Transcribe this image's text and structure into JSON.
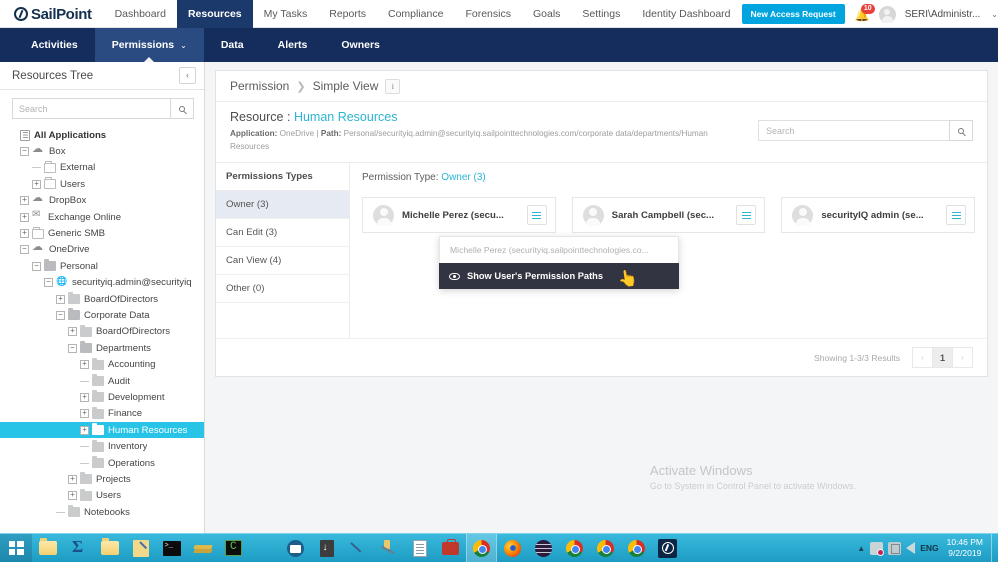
{
  "app": {
    "brand": "SailPoint",
    "brand_icon": "sailpoint-logo-icon"
  },
  "topnav": {
    "items": [
      {
        "label": "Dashboard",
        "active": false
      },
      {
        "label": "Resources",
        "active": true
      },
      {
        "label": "My Tasks",
        "active": false
      },
      {
        "label": "Reports",
        "active": false
      },
      {
        "label": "Compliance",
        "active": false
      },
      {
        "label": "Forensics",
        "active": false
      },
      {
        "label": "Goals",
        "active": false
      },
      {
        "label": "Settings",
        "active": false
      },
      {
        "label": "Identity Dashboard",
        "active": false
      }
    ],
    "new_access_request": "New Access Request",
    "notification_count": "10",
    "user": "SERI\\Administr...",
    "user_caret": "⌄"
  },
  "subnav": {
    "items": [
      {
        "label": "Activities",
        "active": false,
        "caret": ""
      },
      {
        "label": "Permissions",
        "active": true,
        "caret": "⌄"
      },
      {
        "label": "Data",
        "active": false,
        "caret": ""
      },
      {
        "label": "Alerts",
        "active": false,
        "caret": ""
      },
      {
        "label": "Owners",
        "active": false,
        "caret": ""
      }
    ]
  },
  "sidebar": {
    "title": "Resources Tree",
    "collapse_glyph": "‹",
    "search_placeholder": "Search",
    "search_value": "",
    "tree": [
      {
        "label": "All Applications",
        "depth": 0,
        "toggle": "none",
        "icon": "list",
        "bold": true,
        "selected": false
      },
      {
        "label": "Box",
        "depth": 1,
        "toggle": "minus",
        "icon": "cloud",
        "bold": false,
        "selected": false
      },
      {
        "label": "External",
        "depth": 2,
        "toggle": "leaf",
        "icon": "folder-o",
        "bold": false,
        "selected": false
      },
      {
        "label": "Users",
        "depth": 2,
        "toggle": "plus",
        "icon": "folder-o",
        "bold": false,
        "selected": false
      },
      {
        "label": "DropBox",
        "depth": 1,
        "toggle": "plus",
        "icon": "cloud",
        "bold": false,
        "selected": false
      },
      {
        "label": "Exchange Online",
        "depth": 1,
        "toggle": "plus",
        "icon": "mail",
        "bold": false,
        "selected": false
      },
      {
        "label": "Generic SMB",
        "depth": 1,
        "toggle": "plus",
        "icon": "folder-o",
        "bold": false,
        "selected": false
      },
      {
        "label": "OneDrive",
        "depth": 1,
        "toggle": "minus",
        "icon": "cloud",
        "bold": false,
        "selected": false
      },
      {
        "label": "Personal",
        "depth": 2,
        "toggle": "minus",
        "icon": "folder-open",
        "bold": false,
        "selected": false
      },
      {
        "label": "securityiq.admin@securityiq",
        "depth": 3,
        "toggle": "minus",
        "icon": "globe",
        "bold": false,
        "selected": false
      },
      {
        "label": "BoardOfDirectors",
        "depth": 4,
        "toggle": "plus",
        "icon": "folder",
        "bold": false,
        "selected": false
      },
      {
        "label": "Corporate Data",
        "depth": 4,
        "toggle": "minus",
        "icon": "folder-open",
        "bold": false,
        "selected": false
      },
      {
        "label": "BoardOfDirectors",
        "depth": 5,
        "toggle": "plus",
        "icon": "folder",
        "bold": false,
        "selected": false
      },
      {
        "label": "Departments",
        "depth": 5,
        "toggle": "minus",
        "icon": "folder-open",
        "bold": false,
        "selected": false
      },
      {
        "label": "Accounting",
        "depth": 6,
        "toggle": "plus",
        "icon": "folder",
        "bold": false,
        "selected": false
      },
      {
        "label": "Audit",
        "depth": 6,
        "toggle": "leaf",
        "icon": "folder",
        "bold": false,
        "selected": false
      },
      {
        "label": "Development",
        "depth": 6,
        "toggle": "plus",
        "icon": "folder",
        "bold": false,
        "selected": false
      },
      {
        "label": "Finance",
        "depth": 6,
        "toggle": "plus",
        "icon": "folder",
        "bold": false,
        "selected": false
      },
      {
        "label": "Human Resources",
        "depth": 6,
        "toggle": "plus",
        "icon": "folder-open",
        "bold": false,
        "selected": true
      },
      {
        "label": "Inventory",
        "depth": 6,
        "toggle": "leaf",
        "icon": "folder",
        "bold": false,
        "selected": false
      },
      {
        "label": "Operations",
        "depth": 6,
        "toggle": "leaf",
        "icon": "folder",
        "bold": false,
        "selected": false
      },
      {
        "label": "Projects",
        "depth": 5,
        "toggle": "plus",
        "icon": "folder",
        "bold": false,
        "selected": false
      },
      {
        "label": "Users",
        "depth": 5,
        "toggle": "plus",
        "icon": "folder",
        "bold": false,
        "selected": false
      },
      {
        "label": "Notebooks",
        "depth": 4,
        "toggle": "leaf",
        "icon": "folder",
        "bold": false,
        "selected": false
      }
    ]
  },
  "main": {
    "breadcrumb": {
      "root": "Permission",
      "separator": "❯",
      "current": "Simple View",
      "info_glyph": "i"
    },
    "resource_label": "Resource :",
    "resource_name": "Human Resources",
    "meta": {
      "application_key": "Application:",
      "application_value": "OneDrive",
      "divider": "|",
      "path_key": "Path:",
      "path_value": "Personal/securityiq.admin@securityiq.sailpointtechnologies.com/corporate data/departments/Human Resources"
    },
    "search_placeholder": "Search",
    "search_value": "",
    "permission_types_header": "Permissions Types",
    "permission_types": [
      {
        "label": "Owner (3)",
        "active": true
      },
      {
        "label": "Can Edit (3)",
        "active": false
      },
      {
        "label": "Can View (4)",
        "active": false
      },
      {
        "label": "Other (0)",
        "active": false
      }
    ],
    "permission_type_label": "Permission Type:",
    "permission_type_value": "Owner (3)",
    "user_cards": [
      {
        "name": "Michelle Perez (secu...",
        "menu_icon": "hamburger-icon"
      },
      {
        "name": "Sarah Campbell (sec...",
        "menu_icon": "hamburger-icon"
      },
      {
        "name": "securityIQ admin (se...",
        "menu_icon": "hamburger-icon"
      }
    ],
    "dropdown": {
      "header": "Michelle Perez (securityiq.sailpointtechnologies.co...",
      "item_label": "Show User's Permission Paths",
      "item_icon": "eye-icon"
    },
    "footer": {
      "showing": "Showing 1-3/3 Results",
      "prev": "‹",
      "page": "1",
      "next": "›"
    }
  },
  "watermark": {
    "line1": "Activate Windows",
    "line2": "Go to System in Control Panel to activate Windows."
  },
  "taskbar": {
    "start_icon": "windows-start-icon",
    "items": [
      {
        "icon": "printer-icon",
        "kind": "explorer",
        "running": false
      },
      {
        "icon": "sigma-icon",
        "kind": "sigma",
        "running": false
      },
      {
        "icon": "file-explorer-icon",
        "kind": "explorer",
        "running": false
      },
      {
        "icon": "text-editor-icon",
        "kind": "editor",
        "running": false
      },
      {
        "icon": "command-prompt-icon",
        "kind": "cmd",
        "running": false
      },
      {
        "icon": "books-icon",
        "kind": "books",
        "running": false
      },
      {
        "icon": "visual-studio-icon",
        "kind": "vs",
        "running": false
      },
      {
        "icon": "settings-gear-icon",
        "kind": "gear",
        "running": false
      },
      {
        "icon": "outlook-icon",
        "kind": "outlook",
        "running": false
      },
      {
        "icon": "download-icon",
        "kind": "dl",
        "running": false
      },
      {
        "icon": "pen-tool-icon",
        "kind": "pen",
        "running": false
      },
      {
        "icon": "wrench-icon",
        "kind": "wrench",
        "running": false
      },
      {
        "icon": "notepad-icon",
        "kind": "notepad",
        "running": false
      },
      {
        "icon": "toolbox-icon",
        "kind": "toolbox",
        "running": false
      },
      {
        "icon": "chrome-icon",
        "kind": "chrome",
        "running": true
      },
      {
        "icon": "firefox-icon",
        "kind": "firefox",
        "running": false
      },
      {
        "icon": "tor-browser-icon",
        "kind": "tor",
        "running": false
      },
      {
        "icon": "chrome-icon",
        "kind": "chrome",
        "running": false
      },
      {
        "icon": "chrome-icon",
        "kind": "chrome",
        "running": false
      },
      {
        "icon": "chrome-icon",
        "kind": "chrome",
        "running": false
      },
      {
        "icon": "sailpoint-icon",
        "kind": "sailpoint",
        "running": false
      }
    ],
    "tray": {
      "arrow": "▲",
      "language": "ENG",
      "time": "10:46 PM",
      "date": "9/2/2019"
    }
  },
  "colors": {
    "navy": "#142d5c",
    "navy_active": "#1b3a6b",
    "accent_cyan": "#2bb5d1",
    "selection_cyan": "#27c4e8",
    "button_blue": "#00a5e0",
    "badge_red": "#e8403a",
    "dropdown_dark": "#323442",
    "taskbar_blue": "#2aa9cf"
  }
}
